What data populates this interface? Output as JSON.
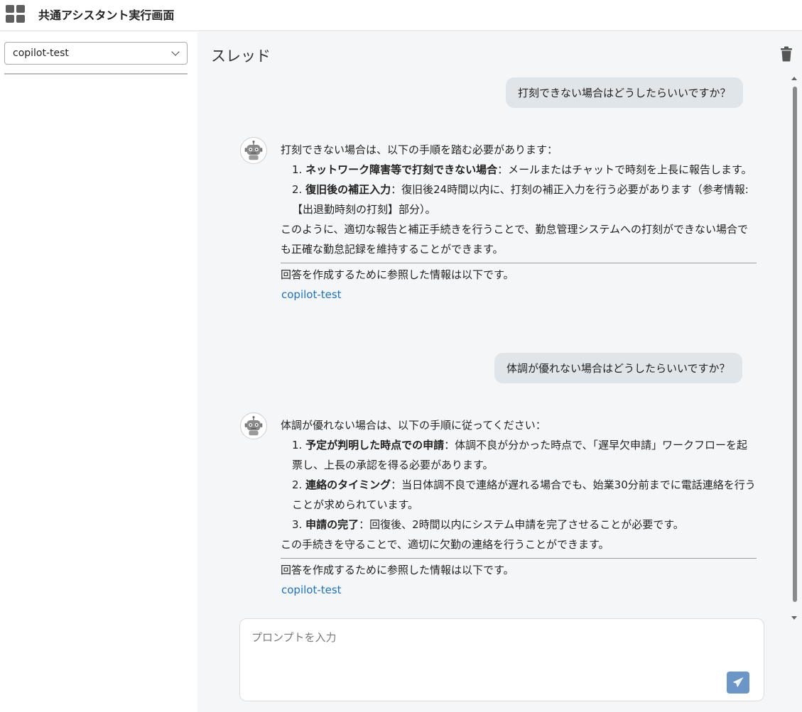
{
  "app": {
    "title": "共通アシスタント実行画面"
  },
  "sidebar": {
    "selected_assistant": "copilot-test"
  },
  "main": {
    "thread_title": "スレッド"
  },
  "messages": [
    {
      "role": "user",
      "text": "打刻できない場合はどうしたらいいですか？"
    },
    {
      "role": "assistant",
      "intro": "打刻できない場合は、以下の手順を踏む必要があります：",
      "items": [
        {
          "num": "1.",
          "title": "ネットワーク障害等で打刻できない場合",
          "text": "：メールまたはチャットで時刻を上長に報告します。"
        },
        {
          "num": "2.",
          "title": "復旧後の補正入力",
          "text": "：復旧後24時間以内に、打刻の補正入力を行う必要があります（参考情報: 【出退勤時刻の打刻】部分）。"
        }
      ],
      "outro": "このように、適切な報告と補正手続きを行うことで、勤怠管理システムへの打刻ができない場合でも正確な勤怠記録を維持することができます。",
      "ref_text": "回答を作成するために参照した情報は以下です。",
      "ref_link": "copilot-test"
    },
    {
      "role": "user",
      "text": "体調が優れない場合はどうしたらいいですか？"
    },
    {
      "role": "assistant",
      "intro": "体調が優れない場合は、以下の手順に従ってください：",
      "items": [
        {
          "num": "1.",
          "title": "予定が判明した時点での申請",
          "text": "：体調不良が分かった時点で、「遅早欠申請」ワークフローを起票し、上長の承認を得る必要があります。"
        },
        {
          "num": "2.",
          "title": "連絡のタイミング",
          "text": "：当日体調不良で連絡が遅れる場合でも、始業30分前までに電話連絡を行うことが求められています。"
        },
        {
          "num": "3.",
          "title": "申請の完了",
          "text": "：回復後、2時間以内にシステム申請を完了させることが必要です。"
        }
      ],
      "outro": "この手続きを守ることで、適切に欠勤の連絡を行うことができます。",
      "ref_text": "回答を作成するために参照した情報は以下です。",
      "ref_link": "copilot-test"
    }
  ],
  "prompt": {
    "placeholder": "プロンプトを入力",
    "value": ""
  },
  "icons": {
    "app": "grid-icon",
    "delete": "trash-icon",
    "avatar": "robot-icon",
    "send": "paper-plane-icon",
    "dropdown": "chevron-down-icon"
  },
  "colors": {
    "user_bubble": "#e0e5ea",
    "main_bg": "#f5f6f7",
    "link": "#1a73c8",
    "send_button": "#6b96c8"
  }
}
